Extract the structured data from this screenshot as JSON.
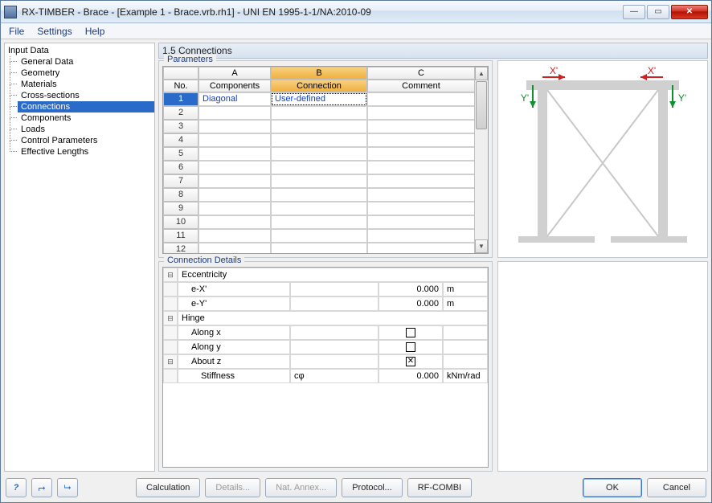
{
  "window": {
    "title": "RX-TIMBER - Brace - [Example 1 - Brace.vrb.rh1] - UNI EN 1995-1-1/NA:2010-09"
  },
  "menu": {
    "file": "File",
    "settings": "Settings",
    "help": "Help"
  },
  "sidebar": {
    "root": "Input Data",
    "items": [
      "General Data",
      "Geometry",
      "Materials",
      "Cross-sections",
      "Connections",
      "Components",
      "Loads",
      "Control Parameters",
      "Effective Lengths"
    ],
    "selected_index": 4
  },
  "section": {
    "title": "1.5 Connections"
  },
  "parameters": {
    "group_label": "Parameters",
    "col_letters": [
      "A",
      "B",
      "C"
    ],
    "row_header": "No.",
    "columns": [
      "Components",
      "Connection",
      "Comment"
    ],
    "rows": [
      {
        "no": "1",
        "components": "Diagonal",
        "connection": "User-defined",
        "comment": ""
      },
      {
        "no": "2",
        "components": "",
        "connection": "",
        "comment": ""
      },
      {
        "no": "3",
        "components": "",
        "connection": "",
        "comment": ""
      },
      {
        "no": "4",
        "components": "",
        "connection": "",
        "comment": ""
      },
      {
        "no": "5",
        "components": "",
        "connection": "",
        "comment": ""
      },
      {
        "no": "6",
        "components": "",
        "connection": "",
        "comment": ""
      },
      {
        "no": "7",
        "components": "",
        "connection": "",
        "comment": ""
      },
      {
        "no": "8",
        "components": "",
        "connection": "",
        "comment": ""
      },
      {
        "no": "9",
        "components": "",
        "connection": "",
        "comment": ""
      },
      {
        "no": "10",
        "components": "",
        "connection": "",
        "comment": ""
      },
      {
        "no": "11",
        "components": "",
        "connection": "",
        "comment": ""
      },
      {
        "no": "12",
        "components": "",
        "connection": "",
        "comment": ""
      }
    ]
  },
  "preview": {
    "labels": {
      "x": "X'",
      "y": "Y'"
    }
  },
  "details": {
    "group_label": "Connection Details",
    "eccentricity": {
      "label": "Eccentricity",
      "ex_label": "e-X'",
      "ex_value": "0.000",
      "ex_unit": "m",
      "ey_label": "e-Y'",
      "ey_value": "0.000",
      "ey_unit": "m"
    },
    "hinge": {
      "label": "Hinge",
      "along_x": {
        "label": "Along x",
        "checked": false
      },
      "along_y": {
        "label": "Along y",
        "checked": false
      },
      "about_z": {
        "label": "About z",
        "checked": true
      },
      "stiffness": {
        "label": "Stiffness",
        "symbol": "cφ",
        "value": "0.000",
        "unit": "kNm/rad"
      }
    }
  },
  "buttons": {
    "help": "?",
    "calculation": "Calculation",
    "details": "Details...",
    "nat_annex": "Nat. Annex...",
    "protocol": "Protocol...",
    "rfcombi": "RF-COMBI",
    "ok": "OK",
    "cancel": "Cancel"
  }
}
